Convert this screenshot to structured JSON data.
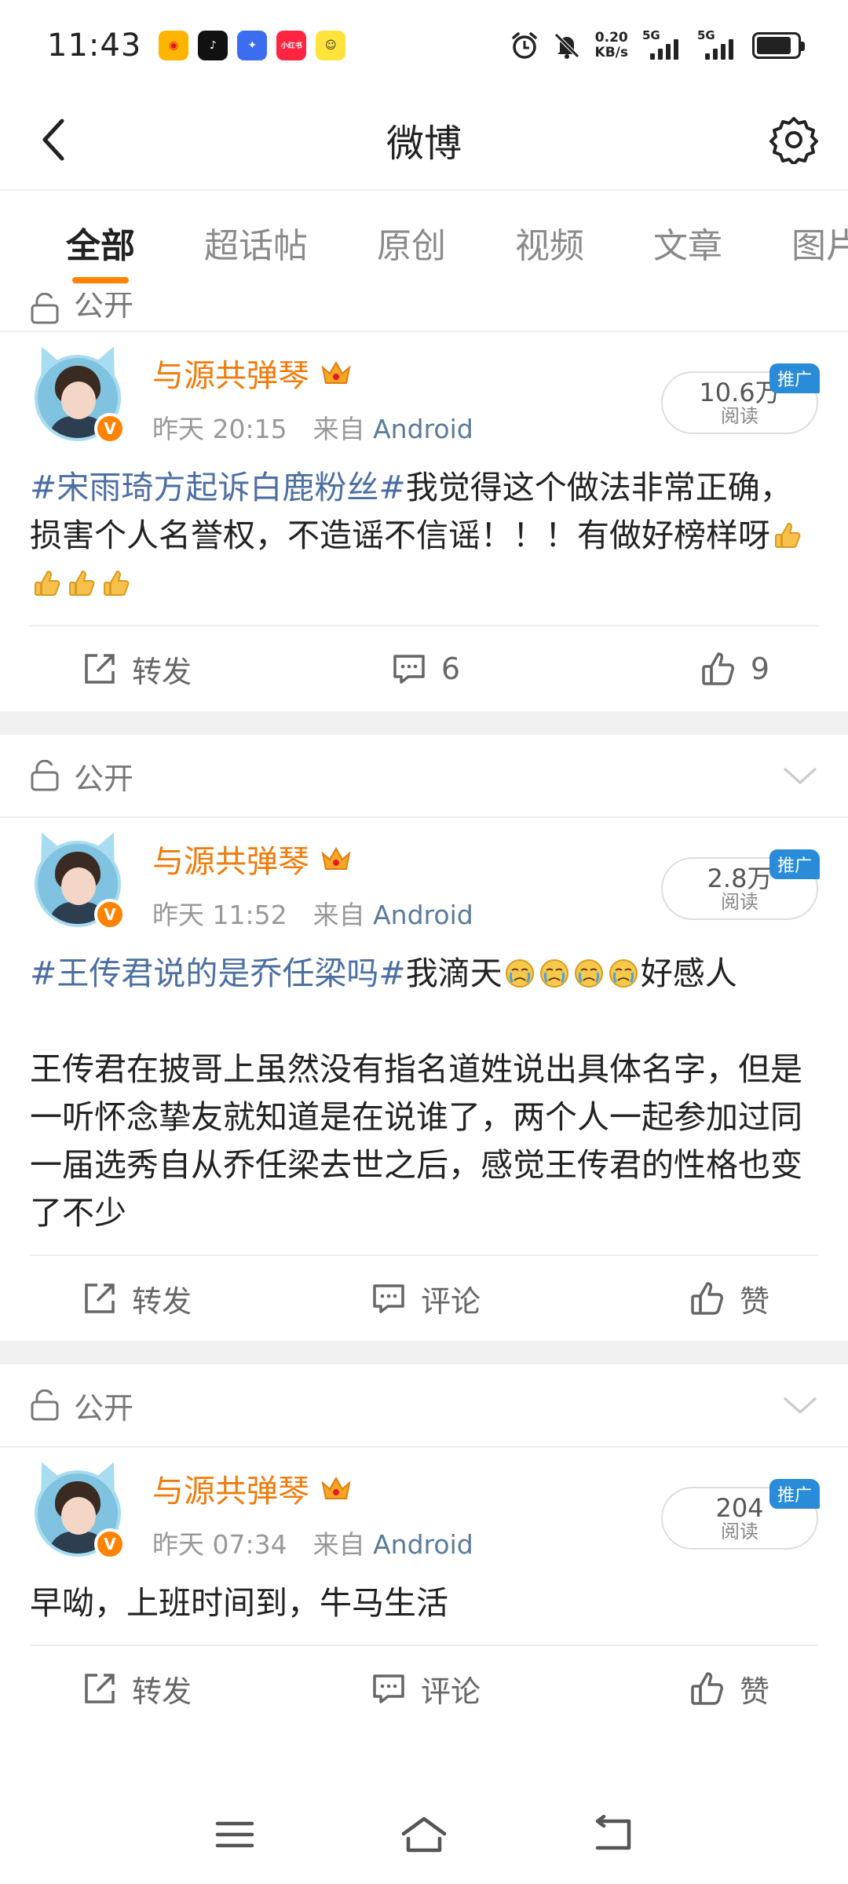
{
  "status_bar": {
    "time": "11:43",
    "apps": [
      "weibo-app",
      "tiktok-app",
      "blue-app",
      "xiaohongshu-app",
      "yellow-app"
    ],
    "xiaohongshu_label": "小红书",
    "net_speed": "0.20",
    "net_unit": "KB/s",
    "signal_1": "5G",
    "signal_2": "5G"
  },
  "header": {
    "title": "微博"
  },
  "tabs": [
    "全部",
    "超话帖",
    "原创",
    "视频",
    "文章",
    "图片"
  ],
  "privacy": {
    "label": "公开"
  },
  "posts": [
    {
      "author": "与源共弹琴",
      "time": "昨天 20:15",
      "source_prefix": "来自",
      "source": "Android",
      "reads": "10.6万",
      "reads_label": "阅读",
      "promo": "推广",
      "hashtag": "#宋雨琦方起诉白鹿粉丝#",
      "text": "我觉得这个做法非常正确，损害个人名誉权，不造谣不信谣！！！有做好榜样呀",
      "repost": "转发",
      "comment": "6",
      "like": "9"
    },
    {
      "author": "与源共弹琴",
      "time": "昨天 11:52",
      "source_prefix": "来自",
      "source": "Android",
      "reads": "2.8万",
      "reads_label": "阅读",
      "promo": "推广",
      "hashtag": "#王传君说的是乔任梁吗#",
      "text": "我滴天",
      "text_after": "好感人",
      "paragraph": "王传君在披哥上虽然没有指名道姓说出具体名字，但是一听怀念挚友就知道是在说谁了，两个人一起参加过同一届选秀自从乔任梁去世之后，感觉王传君的性格也变了不少",
      "repost": "转发",
      "comment": "评论",
      "like": "赞"
    },
    {
      "author": "与源共弹琴",
      "time": "昨天 07:34",
      "source_prefix": "来自",
      "source": "Android",
      "reads": "204",
      "reads_label": "阅读",
      "promo": "推广",
      "text": "早呦，上班时间到，牛马生活",
      "repost": "转发",
      "comment": "评论",
      "like": "赞"
    }
  ],
  "colors": {
    "accent": "#ff8200",
    "author": "#f07b0b",
    "hashtag": "#4c6fa3",
    "promo": "#2a8cd8"
  }
}
